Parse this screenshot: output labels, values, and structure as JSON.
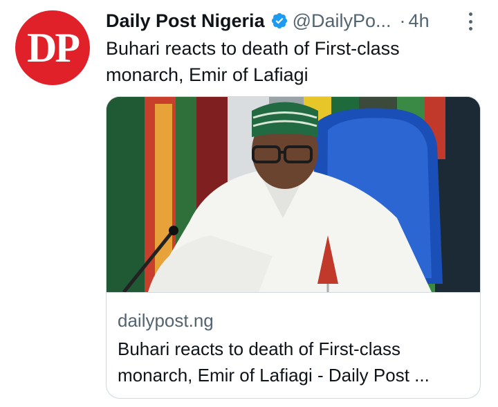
{
  "avatar": {
    "text": "DP",
    "color": "#e12129"
  },
  "author": {
    "name": "Daily Post Nigeria",
    "verified_icon": "verified-badge-icon",
    "handle": "@DailyPo...",
    "separator": "·",
    "time": "4h"
  },
  "menu": {
    "icon": "more-vertical-icon"
  },
  "tweet": {
    "text": "Buhari reacts to death of First-class monarch, Emir of Lafiagi"
  },
  "card": {
    "image_icon": "article-photo",
    "domain": "dailypost.ng",
    "title": "Buhari reacts to death of First-class monarch, Emir of Lafiagi - Daily Post ..."
  },
  "colors": {
    "text": "#0f1419",
    "secondary": "#536471",
    "verified": "#1d9bf0",
    "border": "#cfd9de"
  }
}
